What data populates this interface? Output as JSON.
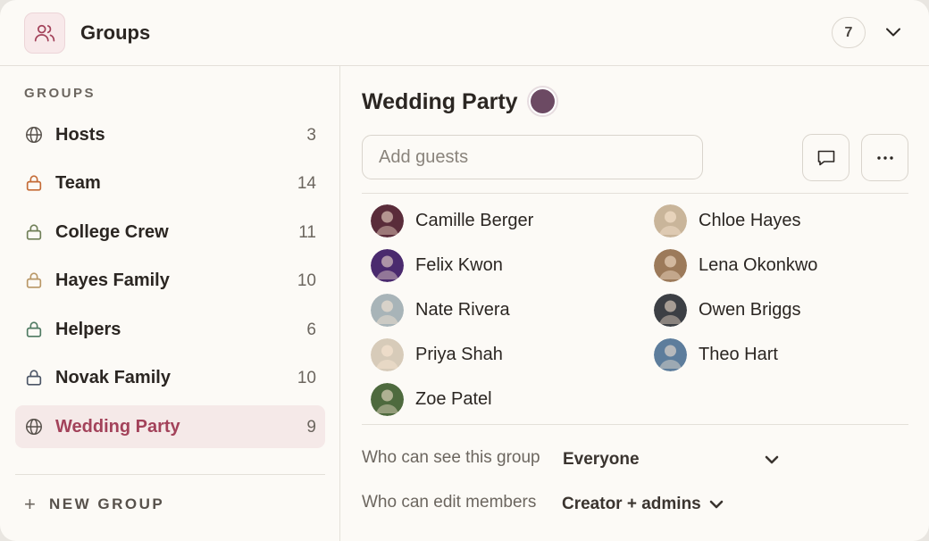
{
  "header": {
    "title": "Groups",
    "count": "7"
  },
  "sidebar": {
    "heading": "GROUPS",
    "items": [
      {
        "label": "Hosts",
        "count": "3",
        "icon": "globe-icon",
        "icon_color": "#57514b",
        "active": false
      },
      {
        "label": "Team",
        "count": "14",
        "icon": "lock-icon",
        "icon_color": "#c46a35",
        "active": false
      },
      {
        "label": "College Crew",
        "count": "11",
        "icon": "lock-icon",
        "icon_color": "#6f7f57",
        "active": false
      },
      {
        "label": "Hayes Family",
        "count": "10",
        "icon": "lock-icon",
        "icon_color": "#b99766",
        "active": false
      },
      {
        "label": "Helpers",
        "count": "6",
        "icon": "lock-icon",
        "icon_color": "#4f7a62",
        "active": false
      },
      {
        "label": "Novak Family",
        "count": "10",
        "icon": "lock-icon",
        "icon_color": "#4b5566",
        "active": false
      },
      {
        "label": "Wedding Party",
        "count": "9",
        "icon": "globe-icon",
        "icon_color": "#57514b",
        "active": true
      }
    ],
    "new_group": "NEW GROUP"
  },
  "main": {
    "title": "Wedding Party",
    "color": "#6c4a63",
    "search_placeholder": "Add guests",
    "guests": [
      {
        "name": "Camille Berger",
        "avatar": "#5a2c3a"
      },
      {
        "name": "Chloe Hayes",
        "avatar": "#c9b59a"
      },
      {
        "name": "Felix Kwon",
        "avatar": "#4a2a6e"
      },
      {
        "name": "Lena Okonkwo",
        "avatar": "#9c7a5a"
      },
      {
        "name": "Nate Rivera",
        "avatar": "#a8b4b8"
      },
      {
        "name": "Owen Briggs",
        "avatar": "#3c3f44"
      },
      {
        "name": "Priya Shah",
        "avatar": "#d7cbb9"
      },
      {
        "name": "Theo Hart",
        "avatar": "#5d7d9c"
      },
      {
        "name": "Zoe Patel",
        "avatar": "#4e6a3e"
      }
    ],
    "visibility": {
      "label": "Who can see this group",
      "value": "Everyone"
    },
    "edit": {
      "label": "Who can edit members",
      "value": "Creator + admins"
    }
  },
  "accent": "#a3425a"
}
